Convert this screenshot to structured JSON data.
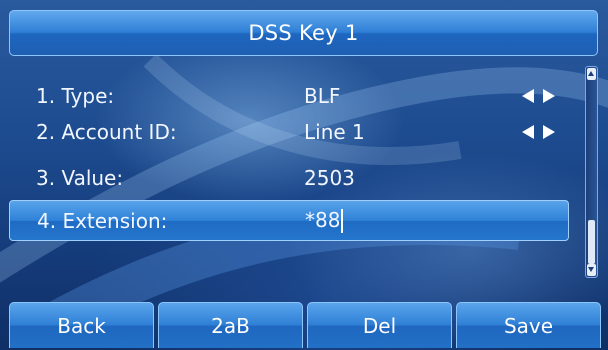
{
  "title": "DSS Key 1",
  "fields": [
    {
      "label": "1. Type:",
      "value": "BLF",
      "has_arrows": true
    },
    {
      "label": "2. Account ID:",
      "value": "Line 1",
      "has_arrows": true
    },
    {
      "label": "3. Value:",
      "value": "2503",
      "has_arrows": false
    },
    {
      "label": "4. Extension:",
      "value": "*88",
      "has_arrows": false,
      "selected": true
    }
  ],
  "softkeys": [
    "Back",
    "2aB",
    "Del",
    "Save"
  ],
  "icons": {
    "left": "arrow-left-icon",
    "right": "arrow-right-icon",
    "scroll_up": "scroll-up-icon",
    "scroll_down": "scroll-down-icon"
  },
  "colors": {
    "background": "#1d4b8f",
    "highlight": "#2f82d8",
    "text": "#ffffff"
  }
}
